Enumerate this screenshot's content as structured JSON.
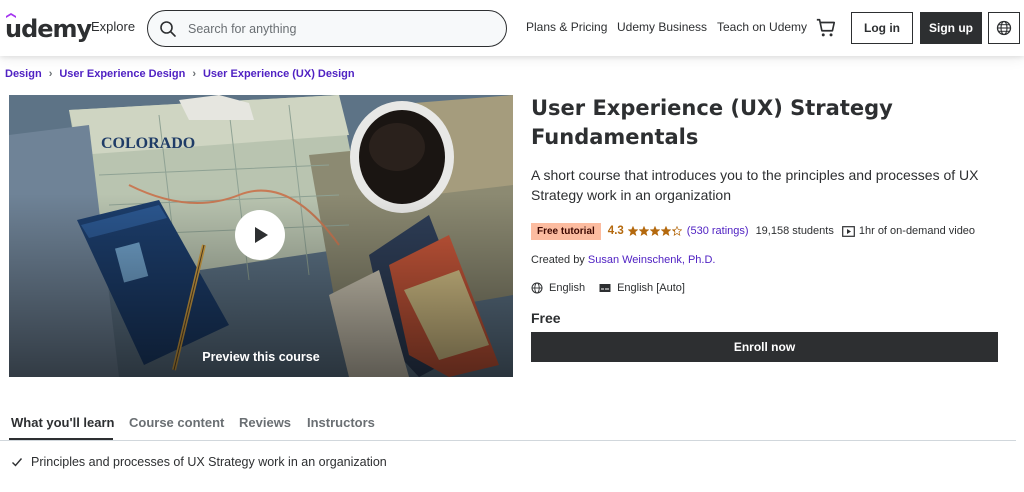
{
  "header": {
    "logo": "udemy",
    "explore": "Explore",
    "search_placeholder": "Search for anything",
    "nav": [
      "Plans & Pricing",
      "Udemy Business",
      "Teach on Udemy"
    ],
    "login": "Log in",
    "signup": "Sign up"
  },
  "breadcrumb": [
    "Design",
    "User Experience Design",
    "User Experience (UX) Design"
  ],
  "preview": {
    "label": "Preview this course"
  },
  "course": {
    "title": "User Experience (UX) Strategy Fundamentals",
    "subtitle": "A short course that introduces you to the principles and processes of UX Strategy work in an organization",
    "badge": "Free tutorial",
    "rating": "4.3",
    "rating_stars": 4.3,
    "ratings_count": "(530 ratings)",
    "students": "19,158 students",
    "video": "1hr of on-demand video",
    "created_by_prefix": "Created by ",
    "author": "Susan Weinschenk, Ph.D.",
    "language": "English",
    "captions": "English [Auto]",
    "price": "Free",
    "enroll": "Enroll now"
  },
  "tabs": [
    "What you'll learn",
    "Course content",
    "Reviews",
    "Instructors"
  ],
  "learn": [
    "Principles and processes of UX Strategy work in an organization"
  ],
  "colors": {
    "accent": "#5022c3",
    "dark": "#2d2f31",
    "star": "#b4690e",
    "badge_bg": "#fcbca0"
  }
}
